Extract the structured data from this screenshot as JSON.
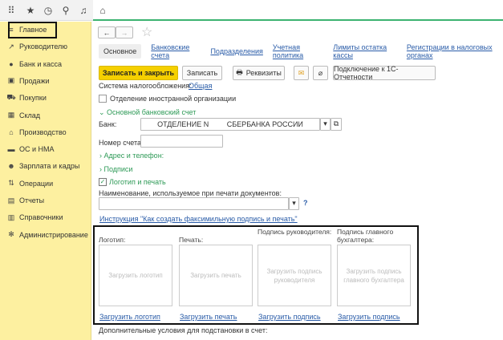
{
  "topbar": {
    "icons": [
      "apps-grid-icon",
      "star-icon",
      "history-icon",
      "search-icon",
      "bell-icon",
      "home-icon"
    ]
  },
  "sidebar": {
    "items": [
      {
        "label": "Главное",
        "icon": "menu-icon",
        "active": true
      },
      {
        "label": "Руководителю",
        "icon": "chart-trend-icon"
      },
      {
        "label": "Банк и касса",
        "icon": "ruble-coin-icon"
      },
      {
        "label": "Продажи",
        "icon": "shopping-bag-icon"
      },
      {
        "label": "Покупки",
        "icon": "cart-icon"
      },
      {
        "label": "Склад",
        "icon": "warehouse-icon"
      },
      {
        "label": "Производство",
        "icon": "factory-icon"
      },
      {
        "label": "ОС и НМА",
        "icon": "truck-icon"
      },
      {
        "label": "Зарплата и кадры",
        "icon": "people-icon"
      },
      {
        "label": "Операции",
        "icon": "operations-icon"
      },
      {
        "label": "Отчеты",
        "icon": "report-icon"
      },
      {
        "label": "Справочники",
        "icon": "book-icon"
      },
      {
        "label": "Администрирование",
        "icon": "gear-icon"
      }
    ]
  },
  "nav": {
    "back": "←",
    "forward": "→",
    "favorite": "☆"
  },
  "tabs": [
    "Основное",
    "Банковские счета",
    "Подразделения",
    "Учетная политика",
    "Лимиты остатка кассы",
    "Регистрации в налоговых органах"
  ],
  "toolbar": {
    "save_close": "Записать и закрыть",
    "save": "Записать",
    "details": "Реквизиты",
    "connect": "Подключение к 1С-Отчетности"
  },
  "form": {
    "tax_label": "Система налогообложения:",
    "tax_value": "Общая",
    "foreign_label": "Отделение иностранной организации",
    "bank_section": "Основной банковский счет",
    "bank_label": "Банк:",
    "bank_value": "ОТДЕЛЕНИЕ N         СБЕРБАНКА РОССИИ",
    "account_label": "Номер счета:",
    "account_value": "",
    "address_section": "Адрес и телефон:",
    "signatures_section": "Подписи",
    "logo_section": "Логотип и печать",
    "print_name_label": "Наименование, используемое при печати документов:",
    "print_name_value": "",
    "help": "?",
    "instruction": "Инструкция \"Как создать факсимильную подпись и печать\"",
    "images": [
      {
        "caption": "Логотип:",
        "placeholder": "Загрузить логотип",
        "link": "Загрузить логотип"
      },
      {
        "caption": "Печать:",
        "placeholder": "Загрузить печать",
        "link": "Загрузить печать"
      },
      {
        "caption": "Подпись руководителя:",
        "placeholder": "Загрузить подпись руководителя",
        "link": "Загрузить подпись"
      },
      {
        "caption": "Подпись главного бухгалтера:",
        "placeholder": "Загрузить подпись главного бухгалтера",
        "link": "Загрузить подпись"
      }
    ],
    "extra_label": "Дополнительные условия для подстановки в счет:"
  }
}
